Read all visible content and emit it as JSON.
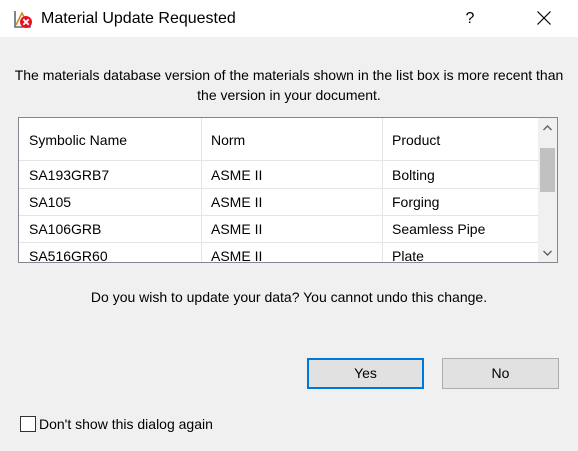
{
  "dialog": {
    "title": "Material Update Requested",
    "help_label": "?",
    "message": "The materials database version of the materials shown in the list box is more recent than the version in your document.",
    "question": "Do you wish to update your data? You cannot undo this change."
  },
  "table": {
    "headers": [
      "Symbolic Name",
      "Norm",
      "Product"
    ],
    "rows": [
      [
        "SA193GRB7",
        "ASME II",
        "Bolting"
      ],
      [
        "SA105",
        "ASME II",
        "Forging"
      ],
      [
        "SA106GRB",
        "ASME II",
        "Seamless Pipe"
      ],
      [
        "SA516GR60",
        "ASME II",
        "Plate"
      ]
    ]
  },
  "buttons": {
    "yes": "Yes",
    "no": "No"
  },
  "checkbox": {
    "label": "Don't show this dialog again",
    "checked": false
  },
  "icons": {
    "app": "material-error-icon",
    "help": "help-icon",
    "close": "close-icon",
    "scroll_up": "scroll-up-icon",
    "scroll_down": "scroll-down-icon"
  },
  "colors": {
    "focus_border": "#0078d7",
    "error_badge": "#e81123"
  }
}
